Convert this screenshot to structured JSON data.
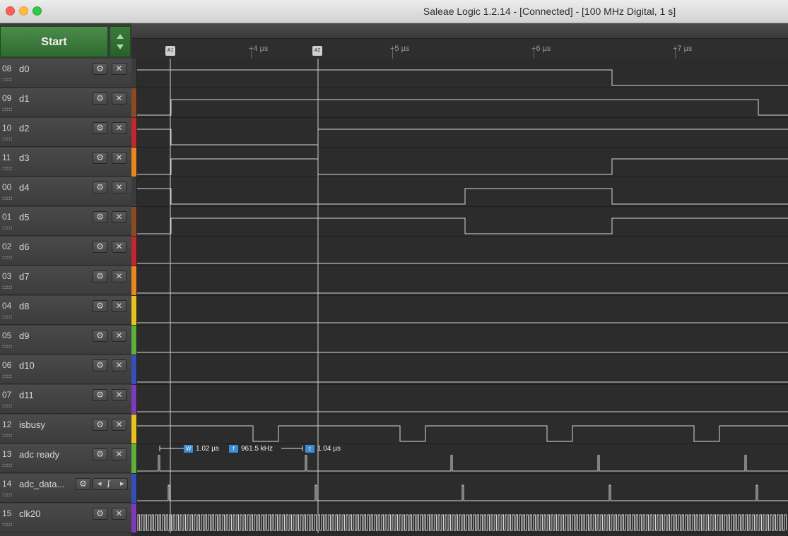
{
  "window": {
    "title": "Saleae Logic 1.2.14 - [Connected] - [100 MHz Digital, 1 s]"
  },
  "toolbar": {
    "start_label": "Start"
  },
  "ruler": {
    "ticks": [
      "+4 µs",
      "+5 µs",
      "+6 µs",
      "+7 µs"
    ],
    "markers": [
      "A1",
      "A2"
    ]
  },
  "channels": [
    {
      "num": "08",
      "name": "d0",
      "color": "#3b3b3b"
    },
    {
      "num": "09",
      "name": "d1",
      "color": "#8b4a22"
    },
    {
      "num": "10",
      "name": "d2",
      "color": "#c1272d"
    },
    {
      "num": "11",
      "name": "d3",
      "color": "#e8871e"
    },
    {
      "num": "00",
      "name": "d4",
      "color": "#3b3b3b"
    },
    {
      "num": "01",
      "name": "d5",
      "color": "#8b4a22"
    },
    {
      "num": "02",
      "name": "d6",
      "color": "#c1272d"
    },
    {
      "num": "03",
      "name": "d7",
      "color": "#e8871e"
    },
    {
      "num": "04",
      "name": "d8",
      "color": "#e8c21e"
    },
    {
      "num": "05",
      "name": "d9",
      "color": "#5fae3a"
    },
    {
      "num": "06",
      "name": "d10",
      "color": "#3450b8"
    },
    {
      "num": "07",
      "name": "d11",
      "color": "#7e3ab8"
    },
    {
      "num": "12",
      "name": "isbusy",
      "color": "#e8c21e"
    },
    {
      "num": "13",
      "name": "adc ready",
      "color": "#5fae3a"
    },
    {
      "num": "14",
      "name": "adc_data...",
      "color": "#3450b8"
    },
    {
      "num": "15",
      "name": "clk20",
      "color": "#7e3ab8"
    }
  ],
  "measurement": {
    "width_icon": "W",
    "width_value": "1.02 µs",
    "freq_icon": "f",
    "freq_value": "961.5 kHz",
    "period_icon": "τ",
    "period_value": "1.04 µs"
  },
  "icons": {
    "gear": "⚙",
    "close": "✕",
    "prev": "◂",
    "next": "▸",
    "proto": "ʄ"
  }
}
